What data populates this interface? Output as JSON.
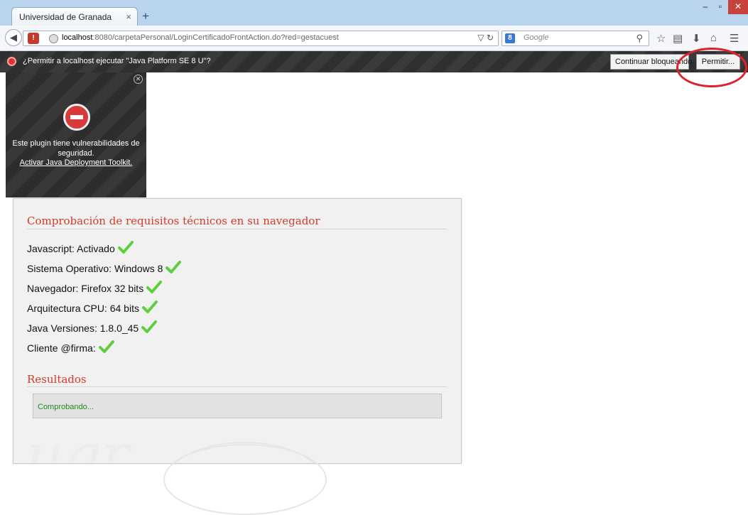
{
  "browser": {
    "tab_title": "Universidad de Granada",
    "tab_close": "×",
    "new_tab": "+",
    "window_controls": {
      "minimize": "–",
      "maximize": "▫",
      "close": "✕"
    },
    "url": {
      "host": "localhost",
      "rest": ":8080/carpetaPersonal/LoginCertificadoFrontAction.do?red=gestacuest"
    },
    "search_placeholder": "Google",
    "search_engine_badge": "8"
  },
  "notification": {
    "message": "¿Permitir a localhost ejecutar \"Java Platform SE 8 U\"?",
    "continue_button": "Continuar bloqueando",
    "permit_button": "Permitir..."
  },
  "plugin_panel": {
    "message": "Este plugin tiene vulnerabilidades de seguridad.",
    "link": "Activar Java Deployment Toolkit."
  },
  "requirements": {
    "title": "Comprobación de requisitos técnicos en su navegador",
    "checks": [
      {
        "label": "Javascript: Activado"
      },
      {
        "label": "Sistema Operativo: Windows 8"
      },
      {
        "label": "Navegador: Firefox 32 bits"
      },
      {
        "label": "Arquitectura CPU: 64 bits"
      },
      {
        "label": "Java Versiones: 1.8.0_45"
      },
      {
        "label": "Cliente @firma:"
      }
    ]
  },
  "results": {
    "title": "Resultados",
    "status": "Comprobando..."
  },
  "colors": {
    "accent_red": "#d23a2a",
    "status_green": "#1e8a1e",
    "check_green": "#5ccf3a"
  }
}
